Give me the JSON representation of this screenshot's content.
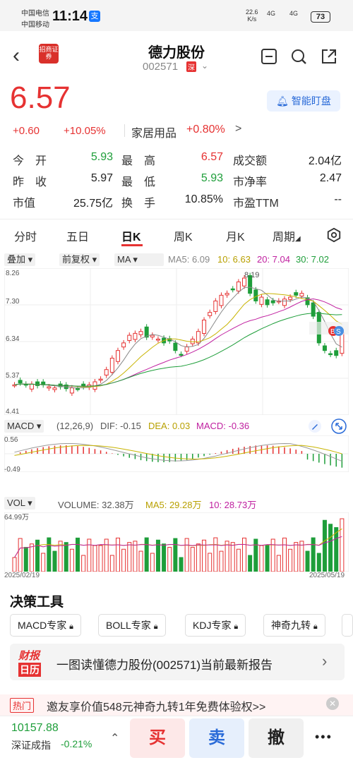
{
  "status": {
    "carrier1": "中国电信",
    "carrier2": "中国移动",
    "time": "11:14",
    "pay": "支",
    "speed_val": "22.6",
    "speed_unit": "K/s",
    "signal1": "4G",
    "signal2": "4G",
    "battery": "73"
  },
  "header": {
    "back_icon": "chevron-left",
    "logo_text": "招商证券",
    "name": "德力股份",
    "code": "002571",
    "market": "深",
    "icons": [
      "minus-box-icon",
      "search-icon",
      "share-icon"
    ]
  },
  "quote": {
    "price": "6.57",
    "change": "+0.60",
    "change_pct": "+10.05%",
    "sector": "家居用品",
    "sector_pct": "+0.80%",
    "sector_arrow": ">",
    "watch_label": "智能盯盘"
  },
  "stats": [
    {
      "l1": "今　开",
      "v1": "5.93",
      "c1": "green",
      "l2": "最　高",
      "v2": "6.57",
      "c2": "red",
      "l3": "成交额",
      "v3": "2.04亿",
      "c3": "dark"
    },
    {
      "l1": "昨　收",
      "v1": "5.97",
      "c1": "dark",
      "l2": "最　低",
      "v2": "5.93",
      "c2": "green",
      "l3": "市净率",
      "v3": "2.47",
      "c3": "dark"
    },
    {
      "l1": "市值",
      "v1": "25.75亿",
      "c1": "dark",
      "l2": "换　手",
      "v2": "10.85%",
      "c2": "dark",
      "l3": "市盈TTM",
      "v3": "--",
      "c3": "dark"
    }
  ],
  "tabs": [
    "分时",
    "五日",
    "日K",
    "周K",
    "月K",
    "周期"
  ],
  "active_tab": "日K",
  "kline": {
    "chip1": "叠加",
    "chip2": "前复权",
    "chip3": "MA",
    "ma5": "MA5: 6.09",
    "ma10": "10: 6.63",
    "ma20": "20: 7.04",
    "ma30": "30: 7.02",
    "y_labels": [
      "8.26",
      "7.30",
      "6.34",
      "5.37",
      "4.41"
    ],
    "high_mark": "8.19",
    "badge_b": "B",
    "badge_s": "S",
    "colors": {
      "up": "#e63232",
      "down": "#1e9e3a",
      "ma5": "#888888",
      "ma10": "#c8b400",
      "ma20": "#c020a0",
      "ma30": "#1e9e3a"
    }
  },
  "macd": {
    "chip": "MACD",
    "params": "(12,26,9)",
    "dif": "DIF: -0.15",
    "dea": "DEA: 0.03",
    "macd": "MACD: -0.36",
    "y_top": "0.56",
    "y_bottom": "-0.49"
  },
  "vol": {
    "chip": "VOL",
    "volume": "VOLUME: 32.38万",
    "ma5": "MA5: 29.28万",
    "ma10": "10: 28.73万",
    "y_top": "64.99万",
    "date_start": "2025/02/19",
    "date_end": "2025/05/19"
  },
  "tools": {
    "title": "决策工具",
    "items": [
      "MACD专家",
      "BOLL专家",
      "KDJ专家",
      "神奇九转"
    ]
  },
  "report": {
    "logo_top": "财报",
    "logo_bottom": "日历",
    "text": "一图读懂德力股份(002571)当前最新报告"
  },
  "hot": {
    "tag": "热门",
    "text": "邀友享价值548元神奇九转1年免费体验权>>"
  },
  "bottom": {
    "index_value": "10157.88",
    "index_name": "深证成指",
    "index_pct": "-0.21%",
    "buy": "买",
    "sell": "卖",
    "cancel": "撤",
    "more": "•••"
  }
}
